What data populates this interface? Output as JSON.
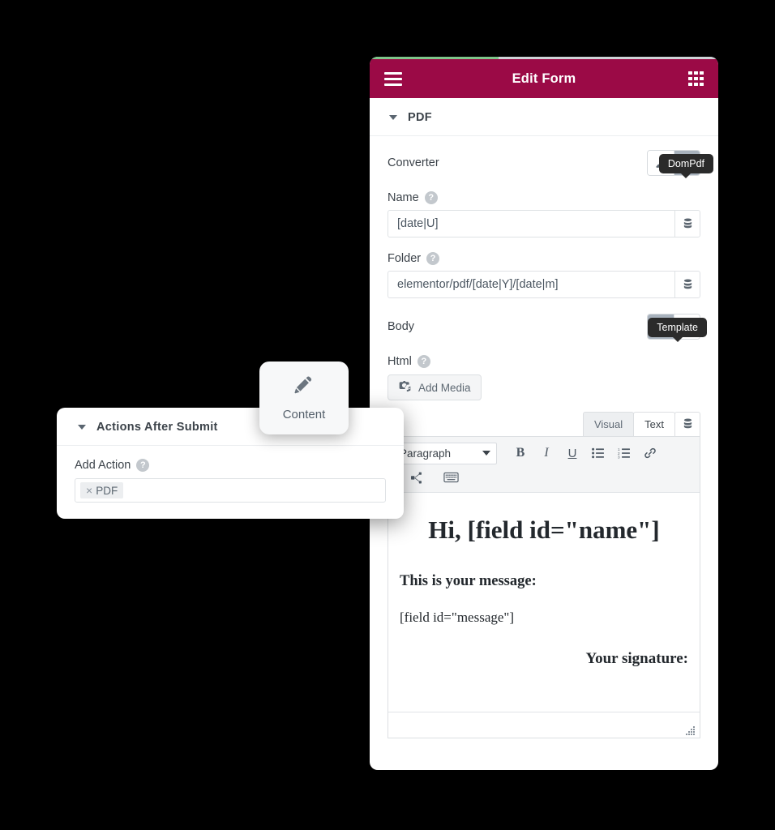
{
  "theme": {
    "header_bg": "#9b0a46",
    "progress_fill": "#7ec68a",
    "tooltip_bg": "#2b2b2b",
    "toggle_active_bg": "#a8b2bd"
  },
  "right_panel": {
    "header": {
      "title": "Edit Form",
      "menu_icon": "hamburger-icon",
      "apps_icon": "apps-grid-icon"
    },
    "progress_percent": 37,
    "section": {
      "label": "PDF",
      "caret_icon": "caret-down-icon"
    },
    "fields": {
      "converter": {
        "label": "Converter",
        "tooltip": "DomPdf",
        "options": [
          {
            "icon": "paintbrush-icon",
            "selected": false
          },
          {
            "icon": "rocket-icon",
            "selected": true
          }
        ]
      },
      "name": {
        "label": "Name",
        "help_icon": "help-icon",
        "value": "[date|U]",
        "placeholder": "",
        "addon_icon": "database-icon"
      },
      "folder": {
        "label": "Folder",
        "help_icon": "help-icon",
        "value": "elementor/pdf/[date|Y]/[date|m]",
        "placeholder": "",
        "addon_icon": "database-icon"
      },
      "body": {
        "label": "Body",
        "tooltip": "Template",
        "options": [
          {
            "icon": "code-icon",
            "selected": true
          },
          {
            "icon": "grid-icon",
            "selected": false
          }
        ]
      },
      "html": {
        "label": "Html",
        "help_icon": "help-icon",
        "add_media_label": "Add Media",
        "add_media_icon": "media-camera-icon"
      }
    },
    "editor": {
      "tabs": [
        {
          "label": "Visual",
          "active": false
        },
        {
          "label": "Text",
          "active": true
        }
      ],
      "shortcode_icon": "database-icon",
      "toolbar": {
        "format_select": "Paragraph",
        "caret_icon": "caret-down-icon",
        "buttons": [
          {
            "label": "B",
            "name": "bold-button"
          },
          {
            "label": "I",
            "name": "italic-button"
          },
          {
            "label": "U",
            "name": "underline-button"
          }
        ],
        "icon_buttons": [
          "bullet-list-icon",
          "numbered-list-icon",
          "link-icon"
        ],
        "row2_icons": [
          "insert-more-icon",
          "keyboard-shortcuts-icon"
        ]
      },
      "content": {
        "heading": "Hi, [field id=\"name\"]",
        "subheading": "This is your message:",
        "paragraph": "[field id=\"message\"]",
        "signature": "Your signature:"
      },
      "resize_icon": "resize-handle-icon"
    }
  },
  "content_card": {
    "label": "Content",
    "icon": "pencil-icon"
  },
  "left_panel": {
    "section": {
      "label": "Actions After Submit",
      "caret_icon": "caret-down-icon"
    },
    "add_action": {
      "label": "Add Action",
      "help_icon": "help-icon",
      "tags": [
        {
          "remove_icon": "close-x-icon",
          "label": "PDF"
        }
      ]
    }
  }
}
